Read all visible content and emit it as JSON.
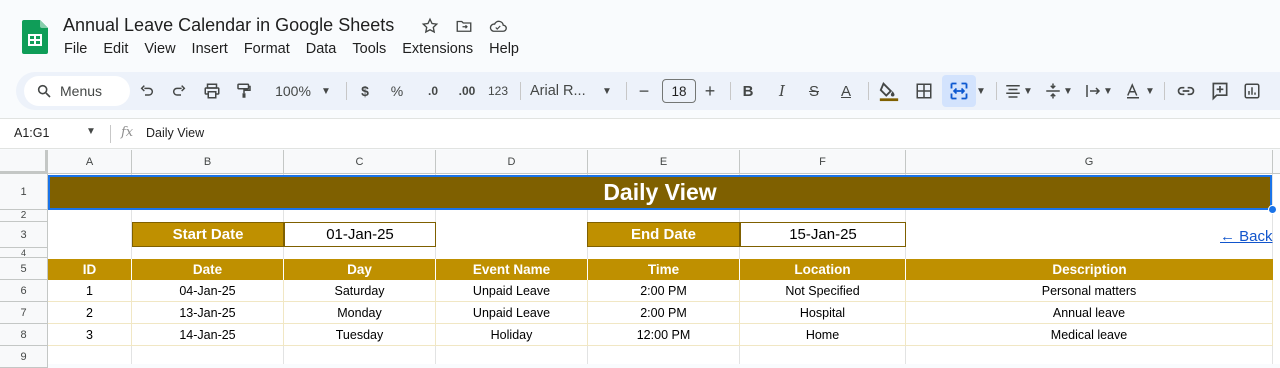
{
  "doc": {
    "title": "Annual Leave Calendar in Google Sheets",
    "menu": [
      "File",
      "Edit",
      "View",
      "Insert",
      "Format",
      "Data",
      "Tools",
      "Extensions",
      "Help"
    ]
  },
  "toolbar": {
    "menus_label": "Menus",
    "zoom": "100%",
    "currency": "$",
    "percent": "%",
    "dec_decrease": ".0",
    "dec_increase": ".00",
    "number_format": "123",
    "font": "Arial R...",
    "font_size": "18",
    "minus": "−",
    "plus": "+",
    "bold": "B",
    "italic": "I",
    "strike": "S",
    "text_color": "A"
  },
  "formula_bar": {
    "name_box": "A1:G1",
    "fx": "fx",
    "content": "Daily View"
  },
  "grid": {
    "columns": [
      "A",
      "B",
      "C",
      "D",
      "E",
      "F",
      "G"
    ],
    "rows": [
      "1",
      "2",
      "3",
      "4",
      "5",
      "6",
      "7",
      "8",
      "9"
    ]
  },
  "sheet": {
    "banner": "Daily View",
    "start_date_label": "Start Date",
    "start_date_value": "01-Jan-25",
    "end_date_label": "End Date",
    "end_date_value": "15-Jan-25",
    "back_link": "← Back",
    "headers": [
      "ID",
      "Date",
      "Day",
      "Event Name",
      "Time",
      "Location",
      "Description"
    ],
    "rows": [
      [
        "1",
        "04-Jan-25",
        "Saturday",
        "Unpaid Leave",
        "2:00 PM",
        "Not Specified",
        "Personal matters"
      ],
      [
        "2",
        "13-Jan-25",
        "Monday",
        "Unpaid Leave",
        "2:00 PM",
        "Hospital",
        "Annual leave"
      ],
      [
        "3",
        "14-Jan-25",
        "Tuesday",
        "Holiday",
        "12:00 PM",
        "Home",
        "Medical leave"
      ]
    ]
  },
  "colors": {
    "banner_bg": "#7f6000",
    "label_bg": "#bf9000",
    "selection": "#1a73e8",
    "sheets_green": "#0f9d58"
  }
}
